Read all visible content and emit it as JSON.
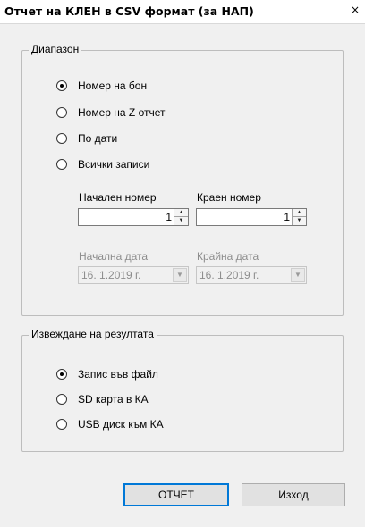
{
  "window": {
    "title": "Отчет на КЛЕН в CSV формат (за НАП)",
    "close_glyph": "×"
  },
  "range_group": {
    "label": "Диапазон",
    "options": [
      {
        "label": "Номер на бон",
        "checked": true
      },
      {
        "label": "Номер на Z отчет",
        "checked": false
      },
      {
        "label": "По дати",
        "checked": false
      },
      {
        "label": "Всички записи",
        "checked": false
      }
    ],
    "start_number_label": "Начален номер",
    "start_number_value": "1",
    "end_number_label": "Краен номер",
    "end_number_value": "1",
    "start_date_label": "Начална дата",
    "start_date_value": "16. 1.2019 г.",
    "end_date_label": "Крайна дата",
    "end_date_value": "16. 1.2019 г."
  },
  "output_group": {
    "label": "Извеждане на резултата",
    "options": [
      {
        "label": "Запис във файл",
        "checked": true
      },
      {
        "label": "SD карта в КА",
        "checked": false
      },
      {
        "label": "USB диск към КА",
        "checked": false
      }
    ]
  },
  "buttons": {
    "report_label": "ОТЧЕТ",
    "exit_label": "Изход"
  },
  "icons": {
    "spin_up": "▲",
    "spin_down": "▼",
    "dropdown": "▼"
  },
  "colors": {
    "window_bg": "#f0f0f0",
    "title_bg": "#ffffff",
    "disabled_text": "#8d8d8d",
    "default_button_border": "#0078d7"
  }
}
